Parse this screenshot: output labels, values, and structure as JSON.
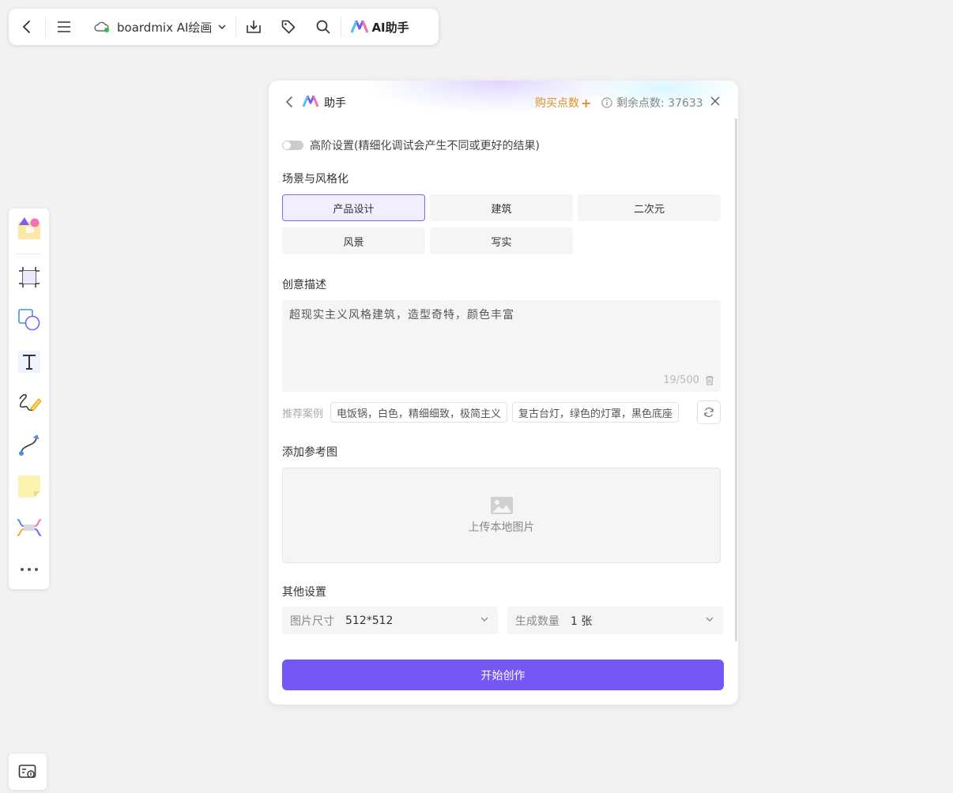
{
  "toolbar": {
    "doc_title": "boardmix AI绘画",
    "ai_label": "AI助手"
  },
  "panel": {
    "title": "助手",
    "buy_label": "购买点数",
    "buy_plus": "+",
    "remaining": "剩余点数: 37633",
    "advanced_label": "高阶设置(精细化调试会产生不同或更好的结果)",
    "advanced_enabled": false,
    "scene_label": "场景与风格化",
    "styles": [
      "产品设计",
      "建筑",
      "二次元",
      "风景",
      "写实"
    ],
    "active_style": "产品设计",
    "desc_label": "创意描述",
    "desc_value": "超现实主义风格建筑，造型奇特，颜色丰富",
    "desc_count": "19/500",
    "rec_label": "推荐案例",
    "rec_items": [
      "电饭锅，白色，精细细致，极简主义",
      "复古台灯，绿色的灯罩，黑色底座"
    ],
    "ref_label": "添加参考图",
    "upload_label": "上传本地图片",
    "other_label": "其他设置",
    "size_label": "图片尺寸",
    "size_value": "512*512",
    "count_label": "生成数量",
    "count_value": "1 张",
    "start_label": "开始创作"
  },
  "colors": {
    "accent": "#7457f5",
    "buy": "#e0902a",
    "active_border": "#7b66f5"
  },
  "icons": {
    "toolbar": [
      "back-icon",
      "menu-icon",
      "cloud-icon",
      "chevron-down-icon",
      "download-icon",
      "tag-icon",
      "search-icon",
      "ai-logo-icon"
    ],
    "leftbar": [
      "templates-icon",
      "frame-icon",
      "shape-icon",
      "text-icon",
      "pen-icon",
      "connector-icon",
      "sticky-note-icon",
      "mindmap-icon",
      "more-icon"
    ],
    "bottom": "presentation-icon"
  }
}
